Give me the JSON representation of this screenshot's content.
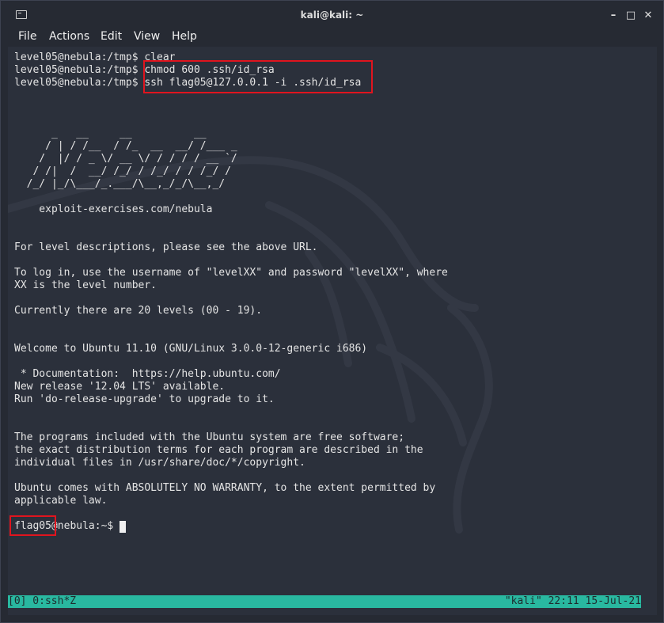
{
  "window": {
    "title": "kali@kali: ~",
    "controls": [
      "–",
      "□",
      "✕"
    ]
  },
  "menu": {
    "items": [
      "File",
      "Actions",
      "Edit",
      "View",
      "Help"
    ]
  },
  "terminal": {
    "lines": [
      "level05@nebula:/tmp$ clear",
      "level05@nebula:/tmp$ chmod 600 .ssh/id_rsa",
      "level05@nebula:/tmp$ ssh flag05@127.0.0.1 -i .ssh/id_rsa",
      "",
      "",
      "",
      "      _   __     __          __",
      "     / | / /__  / /_  __  __/ /___ _",
      "    /  |/ / _ \\/ __ \\/ / / / / __ `/",
      "   / /|  /  __/ /_/ / /_/ / / /_/ /",
      "  /_/ |_/\\___/_.___/\\__,_/_/\\__,_/",
      "",
      "    exploit-exercises.com/nebula",
      "",
      "",
      "For level descriptions, please see the above URL.",
      "",
      "To log in, use the username of \"levelXX\" and password \"levelXX\", where",
      "XX is the level number.",
      "",
      "Currently there are 20 levels (00 - 19).",
      "",
      "",
      "Welcome to Ubuntu 11.10 (GNU/Linux 3.0.0-12-generic i686)",
      "",
      " * Documentation:  https://help.ubuntu.com/",
      "New release '12.04 LTS' available.",
      "Run 'do-release-upgrade' to upgrade to it.",
      "",
      "",
      "The programs included with the Ubuntu system are free software;",
      "the exact distribution terms for each program are described in the",
      "individual files in /usr/share/doc/*/copyright.",
      "",
      "Ubuntu comes with ABSOLUTELY NO WARRANTY, to the extent permitted by",
      "applicable law.",
      "",
      "flag05@nebula:~$ "
    ]
  },
  "status": {
    "left": "[0] 0:ssh*Z",
    "right": "\"kali\" 22:11 15-Jul-21"
  },
  "colors": {
    "highlight": "#e0141e",
    "status_bg": "#29b8a0",
    "terminal_bg": "#2b303b"
  }
}
